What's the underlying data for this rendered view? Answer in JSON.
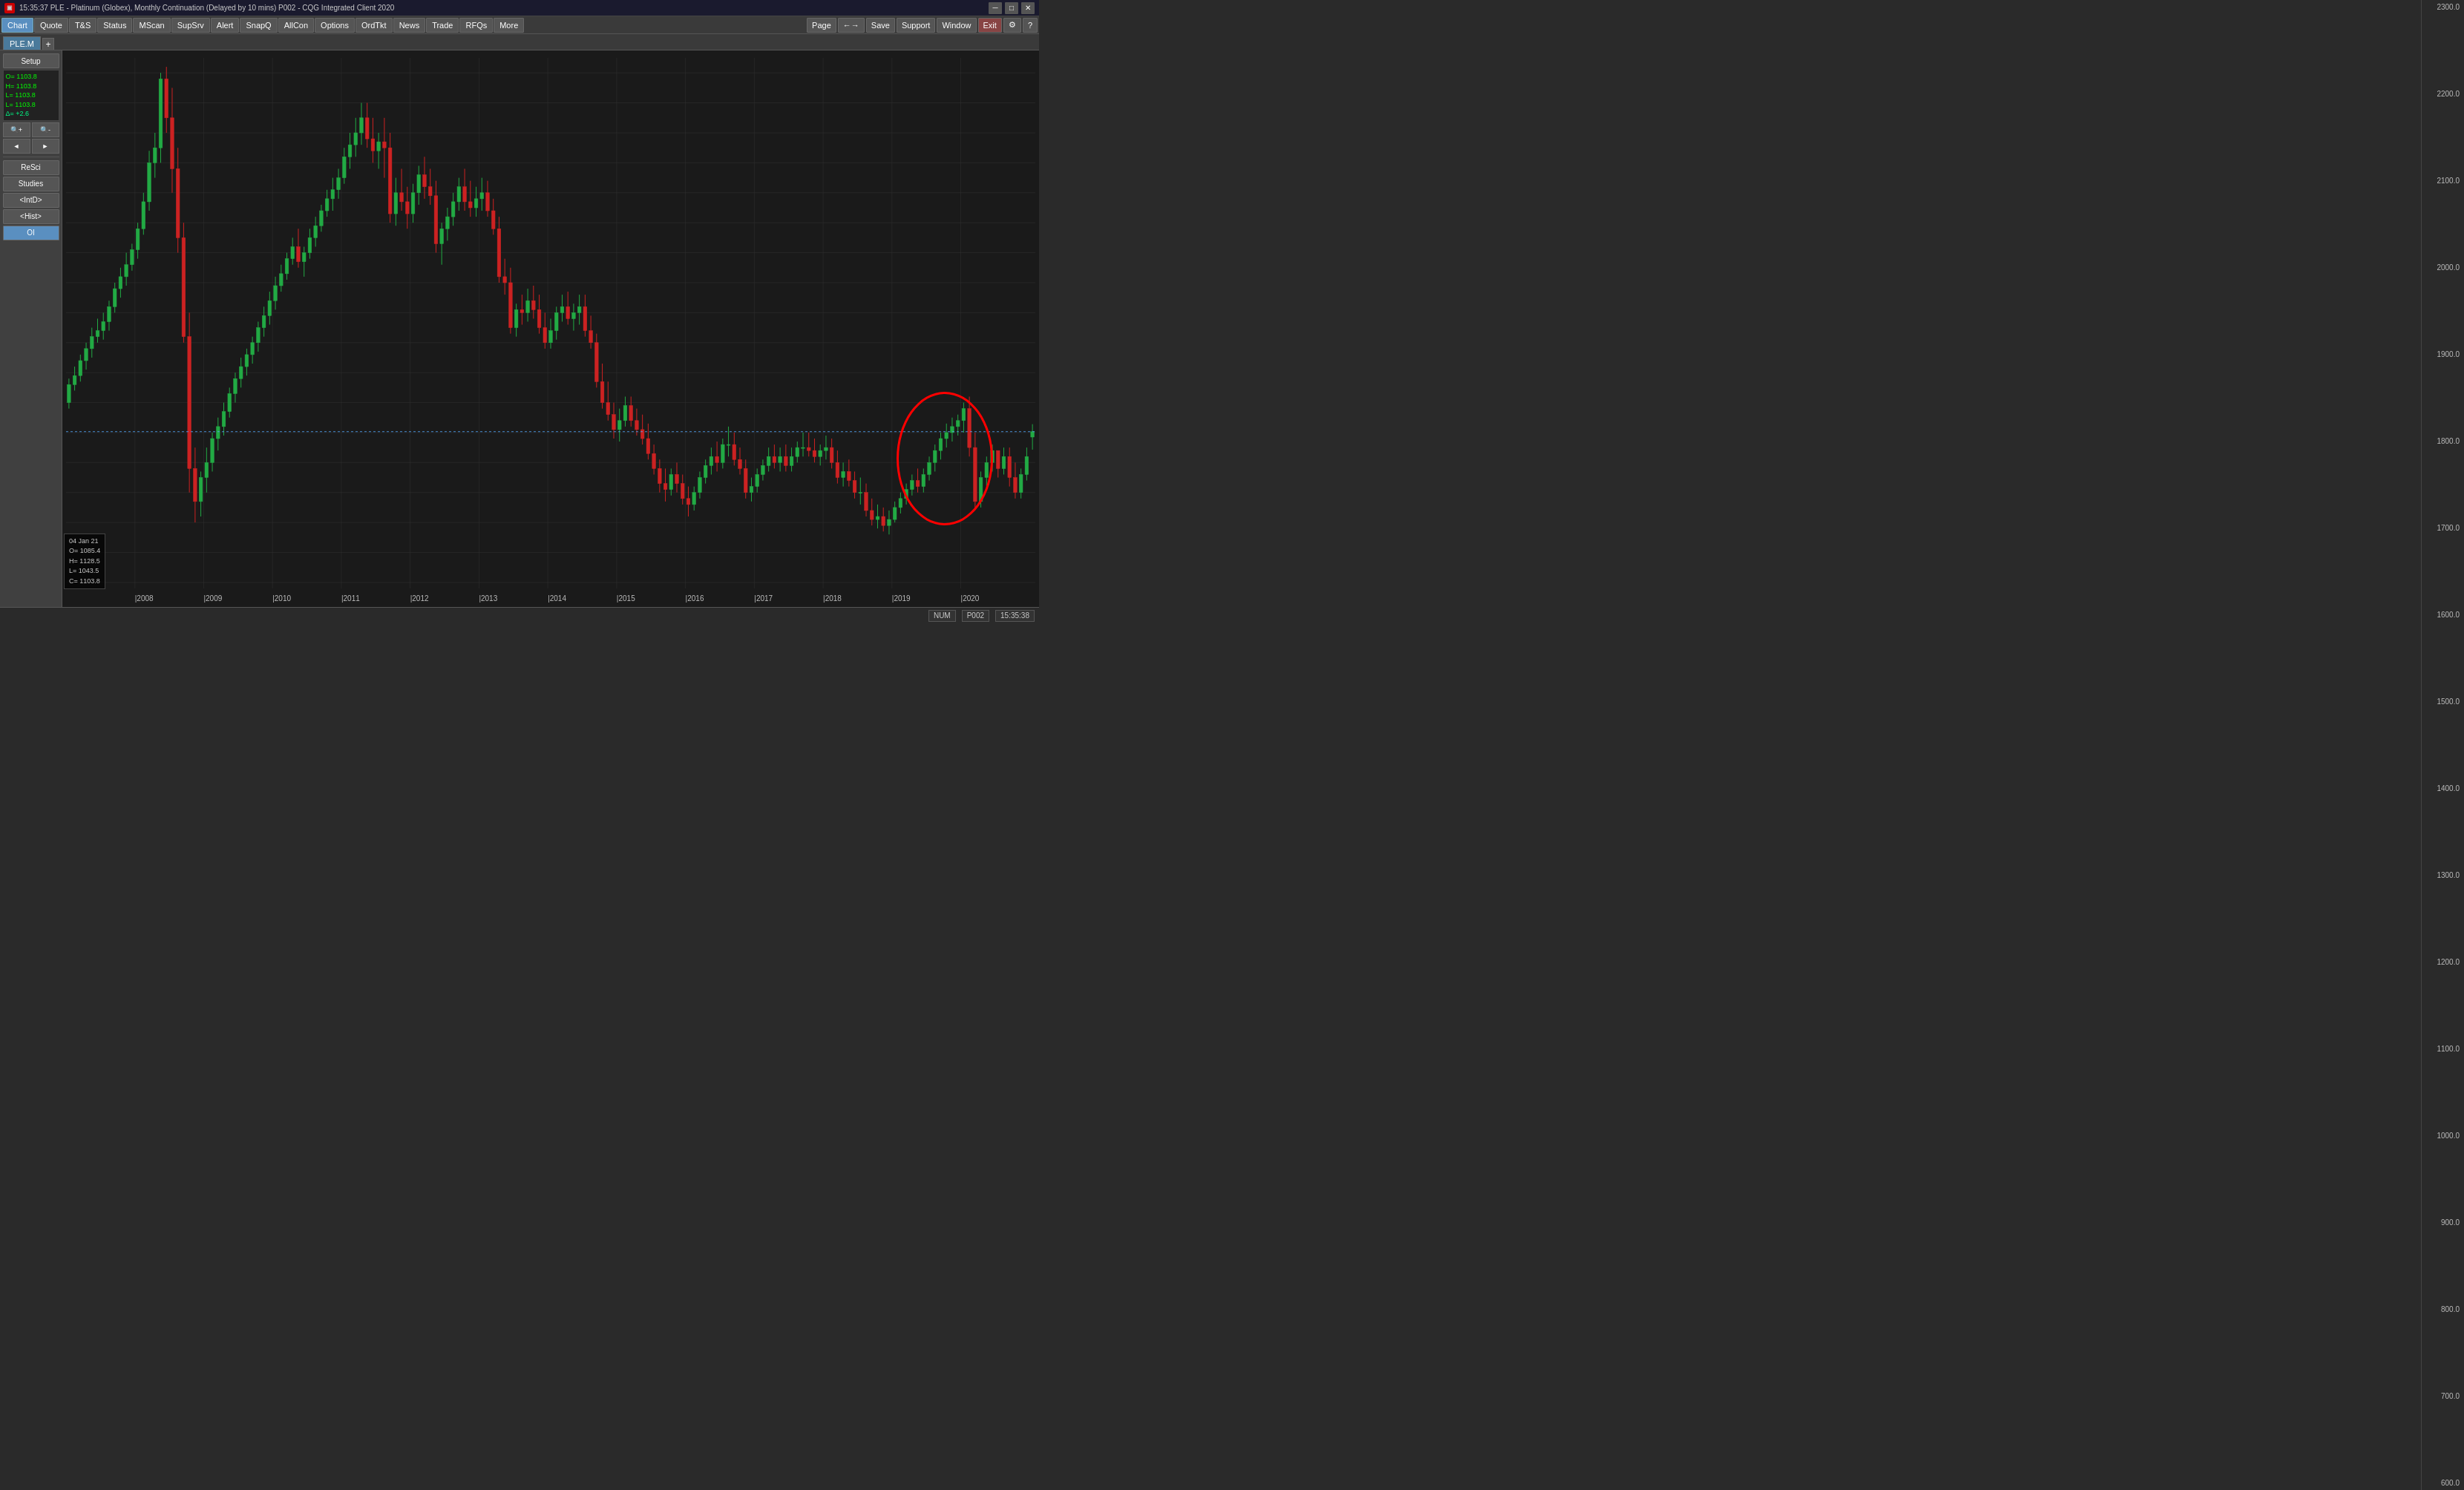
{
  "titleBar": {
    "icon": "PLE",
    "title": "15:35:37   PLE - Platinum (Globex), Monthly Continuation (Delayed by 10 mins)   P002 - CQG Integrated Client 2020",
    "controls": [
      "minimize",
      "maximize",
      "close"
    ]
  },
  "menuBar": {
    "buttons": [
      "Chart",
      "Quote",
      "T&S",
      "Status",
      "MScan",
      "SupSrv",
      "Alert",
      "SnapQ",
      "AllCon",
      "Options",
      "OrdTkt",
      "News",
      "Trade",
      "RFQs",
      "More"
    ],
    "activeButton": "Chart",
    "rightButtons": [
      "Page",
      "←→",
      "Save",
      "Support",
      "Window",
      "Exit",
      "⚙",
      "?"
    ]
  },
  "tabs": {
    "items": [
      "PLE.M"
    ],
    "active": "PLE.M"
  },
  "sidebar": {
    "setupLabel": "Setup",
    "infoLines": [
      "O=  1103.8",
      "H=  1103.8",
      "L=  1103.8",
      "L=  1103.8",
      "Δ=   +2.6"
    ],
    "buttons": [
      "ReSci",
      "Studies",
      "<IntD>",
      "<Hist>",
      "OI"
    ]
  },
  "chart": {
    "priceLabels": [
      "2300.0",
      "2200.0",
      "2100.0",
      "2000.0",
      "1900.0",
      "1800.0",
      "1700.0",
      "1600.0",
      "1500.0",
      "1400.0",
      "1300.0",
      "1200.0",
      "1100.0",
      "1000.0",
      "900.0",
      "800.0",
      "700.0",
      "600.0"
    ],
    "currentPrice": "1103.8",
    "timeLabels": [
      "|2008",
      "|2009",
      "|2010",
      "|2011",
      "|2012",
      "|2013",
      "|2014",
      "|2015",
      "|2016",
      "|2017",
      "|2018",
      "|2019",
      "|2020"
    ],
    "timeLabelPositions": [
      4,
      8.5,
      14,
      19.5,
      25.5,
      31,
      36.5,
      42.5,
      48.5,
      54,
      60,
      66,
      72.5
    ],
    "gridLines": 18,
    "infoBox": {
      "date": "04  Jan  21",
      "open": "O=  1085.4",
      "high": "H=  1128.5",
      "low": "L=  1043.5",
      "close": "C=  1103.8"
    }
  },
  "statusBar": {
    "items": [
      "NUM",
      "P002",
      "15:35:38"
    ]
  }
}
